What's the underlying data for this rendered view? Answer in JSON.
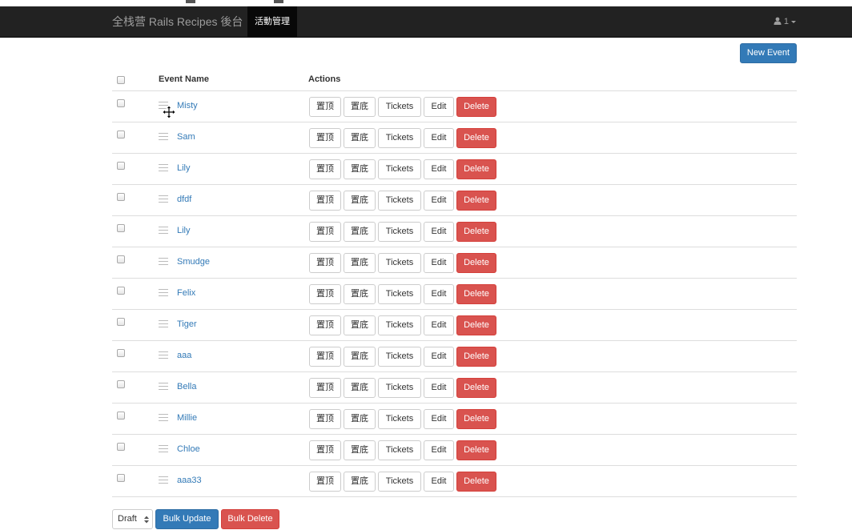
{
  "navbar": {
    "brand": "全栈营 Rails Recipes 後台",
    "active_item": "活動管理",
    "user_label": "1"
  },
  "toolbar": {
    "new_event_label": "New Event"
  },
  "table": {
    "columns": [
      "Event Name",
      "Actions"
    ],
    "row_actions": {
      "top": "置顶",
      "bottom": "置底",
      "tickets": "Tickets",
      "edit": "Edit",
      "delete": "Delete"
    },
    "rows": [
      {
        "name": "Misty"
      },
      {
        "name": "Sam"
      },
      {
        "name": "Lily"
      },
      {
        "name": "dfdf"
      },
      {
        "name": "Lily"
      },
      {
        "name": "Smudge"
      },
      {
        "name": "Felix"
      },
      {
        "name": "Tiger"
      },
      {
        "name": "aaa"
      },
      {
        "name": "Bella"
      },
      {
        "name": "Millie"
      },
      {
        "name": "Chloe"
      },
      {
        "name": "aaa33"
      }
    ]
  },
  "footer": {
    "status_selected": "Draft",
    "bulk_update_label": "Bulk Update",
    "bulk_delete_label": "Bulk Delete"
  },
  "colors": {
    "navbar_bg": "#222222",
    "primary": "#337ab7",
    "danger": "#d9534f",
    "link": "#337ab7"
  },
  "icons": [
    "user-icon",
    "caret-down-icon",
    "drag-handle-icon",
    "move-cursor-icon",
    "select-arrows-icon"
  ]
}
